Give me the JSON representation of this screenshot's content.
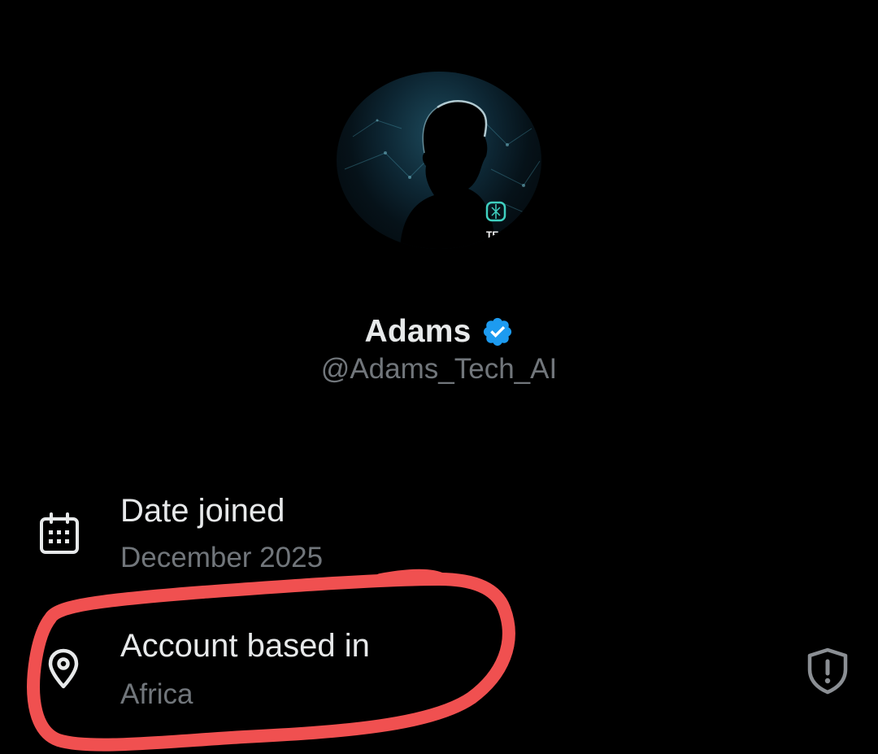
{
  "profile": {
    "display_name": "Adams",
    "handle": "@Adams_Tech_AI",
    "verified": true,
    "avatar_badge_text": "TEC"
  },
  "about": {
    "date_joined": {
      "label": "Date joined",
      "value": "December 2025",
      "icon": "calendar-icon"
    },
    "account_location": {
      "label": "Account based in",
      "value": "Africa",
      "icon": "location-pin-icon"
    },
    "trailing_icon": "shield-alert-icon"
  },
  "colors": {
    "background": "#000000",
    "primary_text": "#e7e9ea",
    "secondary_text": "#71767b",
    "verified_blue": "#1d9bf0",
    "annotation_red": "#f05050"
  }
}
